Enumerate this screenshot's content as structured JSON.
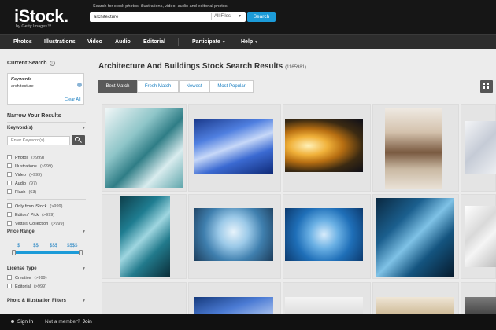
{
  "header": {
    "logo": "iStock.",
    "logo_sub": "by Getty Images™",
    "search_hint": "Search for stock photos, illustrations, video, audio and editorial photos",
    "search_value": "architecture",
    "search_filter": "All Files",
    "search_button": "Search"
  },
  "nav": {
    "items": [
      "Photos",
      "Illustrations",
      "Video",
      "Audio",
      "Editorial",
      "Participate",
      "Help"
    ]
  },
  "sidebar": {
    "current_search_heading": "Current Search",
    "keywords_label": "Keywords",
    "keywords_value": "architecture",
    "clear_all": "Clear All",
    "narrow_heading": "Narrow Your Results",
    "keywords_heading": "Keyword(s)",
    "keyword_placeholder": "Enter Keyword(s)",
    "file_types": [
      {
        "label": "Photos",
        "count": "(>999)"
      },
      {
        "label": "Illustrations",
        "count": "(>999)"
      },
      {
        "label": "Video",
        "count": "(>999)"
      },
      {
        "label": "Audio",
        "count": "(97)"
      },
      {
        "label": "Flash",
        "count": "(63)"
      }
    ],
    "collections": [
      {
        "label": "Only from iStock",
        "count": "(>999)"
      },
      {
        "label": "Editors' Pick",
        "count": "(>999)"
      },
      {
        "label": "Vetta® Collection",
        "count": "(>999)"
      }
    ],
    "price_heading": "Price Range",
    "price_ticks": [
      "$",
      "$$",
      "$$$",
      "$$$$"
    ],
    "license_heading": "License Type",
    "licenses": [
      {
        "label": "Creative",
        "count": "(>999)"
      },
      {
        "label": "Editorial",
        "count": "(>999)"
      }
    ],
    "filters_heading": "Photo & Illustration Filters"
  },
  "main": {
    "title": "Architecture And Buildings Stock Search Results",
    "count": "(1165981)",
    "sort_tabs": [
      "Best Match",
      "Fresh Match",
      "Newest",
      "Most Popular"
    ],
    "active_tab": "Best Match"
  },
  "footer": {
    "sign_in": "Sign In",
    "not_member": "Not a member?",
    "join": "Join"
  },
  "colors": {
    "accent": "#1c9bd8",
    "topbar": "#161616",
    "navbar": "#2d2d2d"
  }
}
